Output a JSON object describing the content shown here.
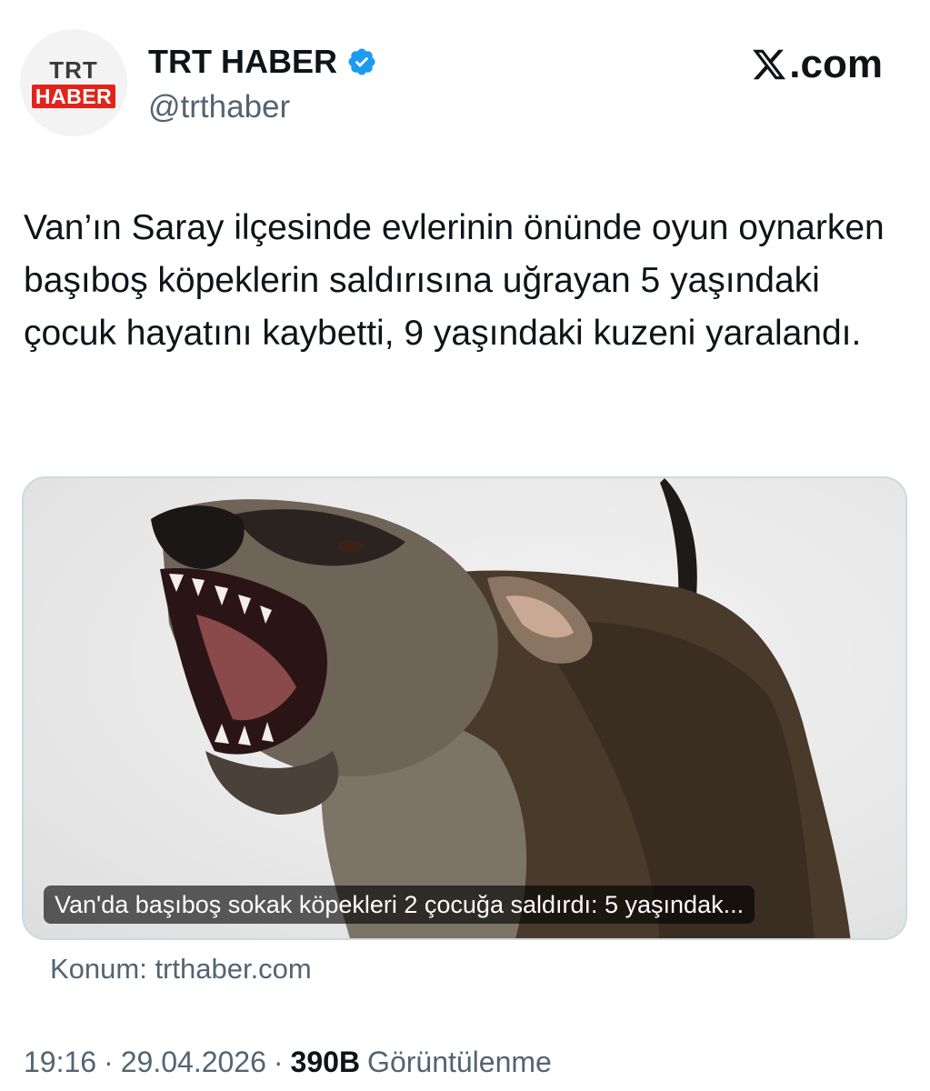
{
  "header": {
    "avatar_line1": "TRT",
    "avatar_line2": "HABER",
    "display_name": "TRT HABER",
    "handle": "@trthaber",
    "site_label": ".com",
    "verified_icon": "verified-badge-icon",
    "colors": {
      "brand_red": "#e2231a",
      "verified_blue": "#1d9bf0",
      "muted_text": "#536471"
    }
  },
  "tweet": {
    "text": "Van’ın Saray ilçesinde evlerinin önünde oyun oynarken başıboş köpeklerin saldırısına uğrayan 5 yaşındaki çocuk hayatını kaybetti, 9 yaşındaki kuzeni yaralandı."
  },
  "card": {
    "image_icon": "dog-photo",
    "caption": "Van'da başıboş sokak köpekleri 2 çocuğa saldırdı: 5 yaşındak...",
    "source": "Konum: trthaber.com"
  },
  "meta": {
    "time": "19:16",
    "separator": "·",
    "date": "29.04.2026",
    "views": "390B",
    "views_label": "Görüntülenme"
  }
}
